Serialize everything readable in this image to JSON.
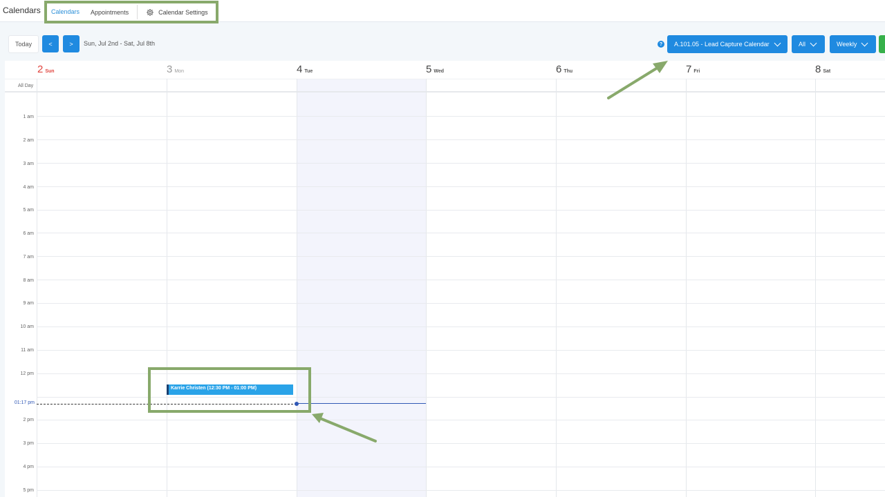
{
  "app": {
    "title": "Calendars"
  },
  "tabs": [
    {
      "label": "Calendars",
      "active": true
    },
    {
      "label": "Appointments",
      "active": false
    },
    {
      "label": "Calendar Settings",
      "active": false,
      "icon": "gear-icon"
    }
  ],
  "toolbar": {
    "today_label": "Today",
    "prev_label": "<",
    "next_label": ">",
    "range": "Sun, Jul 2nd - Sat, Jul 8th",
    "help_label": "?",
    "calendar_select": "A.101.05 - Lead Capture Calendar",
    "filter_select": "All",
    "view_select": "Weekly"
  },
  "calendar": {
    "all_day_label": "All Day",
    "days": [
      {
        "num": "2",
        "name": "Sun"
      },
      {
        "num": "3",
        "name": "Mon"
      },
      {
        "num": "4",
        "name": "Tue"
      },
      {
        "num": "5",
        "name": "Wed"
      },
      {
        "num": "6",
        "name": "Thu"
      },
      {
        "num": "7",
        "name": "Fri"
      },
      {
        "num": "8",
        "name": "Sat"
      }
    ],
    "hours": [
      "1 am",
      "2 am",
      "3 am",
      "4 am",
      "5 am",
      "6 am",
      "7 am",
      "8 am",
      "9 am",
      "10 am",
      "11 am",
      "12 pm",
      "",
      "2 pm",
      "3 pm",
      "4 pm",
      "5 pm"
    ],
    "now_label": "01:17 pm",
    "event": {
      "title": "Karrie Christen (12:30 PM - 01:00 PM)"
    }
  },
  "colors": {
    "accent": "#1f8ae0",
    "sunday": "#e0443e",
    "past_day": "#9a9a9a",
    "today_bg": "#f3f4fc",
    "annotation": "#88a96b",
    "now_line": "#2f57b5"
  }
}
